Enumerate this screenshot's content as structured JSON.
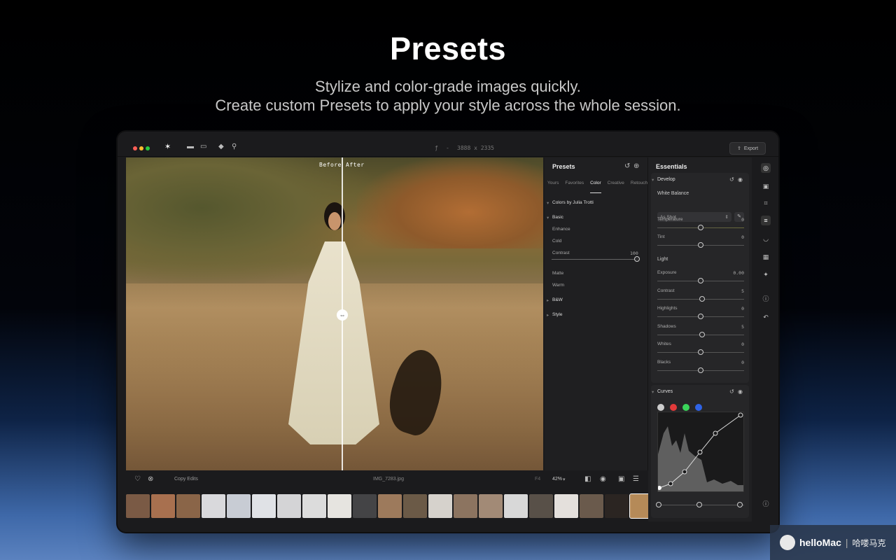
{
  "hero": {
    "title": "Presets",
    "subtitle_line1": "Stylize and color-grade images quickly.",
    "subtitle_line2": "Create custom Presets to apply your style across the whole session."
  },
  "titlebar": {
    "meta_f": "ƒ",
    "meta_dash": "-",
    "dimensions": "3888 x 2335",
    "export_label": "Export",
    "traffic_colors": [
      "#ff5f57",
      "#febc2e",
      "#28c840"
    ]
  },
  "viewer": {
    "before_label": "Before",
    "after_label": "After",
    "split_handle_icon": "⇔"
  },
  "bottombar": {
    "copy_edits": "Copy Edits",
    "filename": "IMG_7283.jpg",
    "f4_label": "F4",
    "zoom": "42%",
    "zoom_chevron": "▾"
  },
  "presets_panel": {
    "title": "Presets",
    "tabs": [
      "Yours",
      "Favorites",
      "Color",
      "Creative",
      "Retouch"
    ],
    "active_tab": "Color",
    "group_julia": "Colors by Julia Trotti",
    "group_basic": "Basic",
    "items": [
      "Enhance",
      "Cold",
      "Contrast",
      "Matte",
      "Warm"
    ],
    "contrast_value": "100",
    "contrast_amount": 1.0,
    "group_bw": "B&W",
    "group_style": "Style"
  },
  "essentials": {
    "title": "Essentials",
    "develop_title": "Develop",
    "white_balance_label": "White Balance",
    "wb_select": "As Shot",
    "temperature": {
      "label": "Temperature",
      "value": "0"
    },
    "tint": {
      "label": "Tint",
      "value": "0"
    },
    "light_label": "Light",
    "light_sliders": [
      {
        "label": "Exposure",
        "value": "0.00",
        "pos": 0.5
      },
      {
        "label": "Contrast",
        "value": "5",
        "pos": 0.52
      },
      {
        "label": "Highlights",
        "value": "0",
        "pos": 0.5
      },
      {
        "label": "Shadows",
        "value": "5",
        "pos": 0.52
      },
      {
        "label": "Whites",
        "value": "0",
        "pos": 0.5
      },
      {
        "label": "Blacks",
        "value": "0",
        "pos": 0.5
      }
    ],
    "curves_title": "Curves",
    "curve_channels": [
      "#cccccc",
      "#e23a3a",
      "#3ad45a",
      "#2f63e6"
    ]
  },
  "watermark": {
    "brand": "helloMac",
    "cn": "哈喽马克"
  }
}
